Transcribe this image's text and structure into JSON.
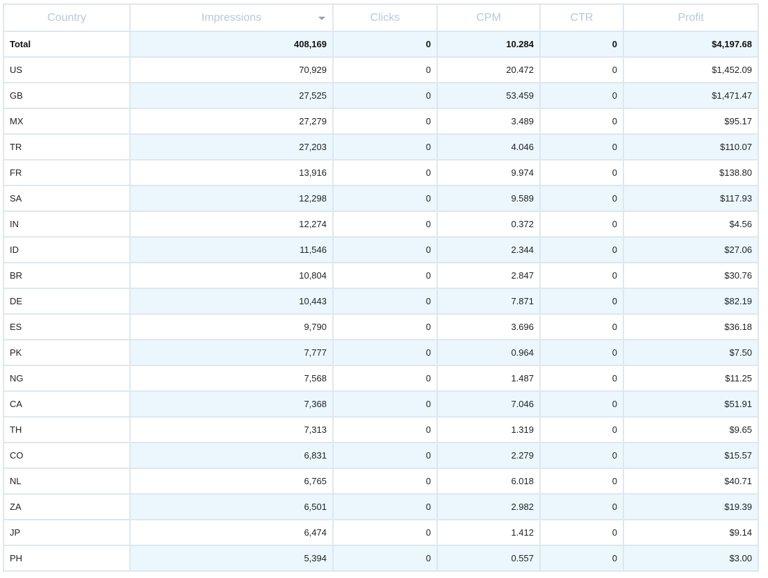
{
  "table": {
    "headers": {
      "country": "Country",
      "impressions": "Impressions",
      "clicks": "Clicks",
      "cpm": "CPM",
      "ctr": "CTR",
      "profit": "Profit"
    },
    "sort": {
      "column": "impressions",
      "direction": "desc",
      "icon": "chevron-down-icon"
    },
    "total": {
      "country": "Total",
      "impressions": "408,169",
      "clicks": "0",
      "cpm": "10.284",
      "ctr": "0",
      "profit": "$4,197.68"
    },
    "rows": [
      {
        "country": "US",
        "impressions": "70,929",
        "clicks": "0",
        "cpm": "20.472",
        "ctr": "0",
        "profit": "$1,452.09"
      },
      {
        "country": "GB",
        "impressions": "27,525",
        "clicks": "0",
        "cpm": "53.459",
        "ctr": "0",
        "profit": "$1,471.47"
      },
      {
        "country": "MX",
        "impressions": "27,279",
        "clicks": "0",
        "cpm": "3.489",
        "ctr": "0",
        "profit": "$95.17"
      },
      {
        "country": "TR",
        "impressions": "27,203",
        "clicks": "0",
        "cpm": "4.046",
        "ctr": "0",
        "profit": "$110.07"
      },
      {
        "country": "FR",
        "impressions": "13,916",
        "clicks": "0",
        "cpm": "9.974",
        "ctr": "0",
        "profit": "$138.80"
      },
      {
        "country": "SA",
        "impressions": "12,298",
        "clicks": "0",
        "cpm": "9.589",
        "ctr": "0",
        "profit": "$117.93"
      },
      {
        "country": "IN",
        "impressions": "12,274",
        "clicks": "0",
        "cpm": "0.372",
        "ctr": "0",
        "profit": "$4.56"
      },
      {
        "country": "ID",
        "impressions": "11,546",
        "clicks": "0",
        "cpm": "2.344",
        "ctr": "0",
        "profit": "$27.06"
      },
      {
        "country": "BR",
        "impressions": "10,804",
        "clicks": "0",
        "cpm": "2.847",
        "ctr": "0",
        "profit": "$30.76"
      },
      {
        "country": "DE",
        "impressions": "10,443",
        "clicks": "0",
        "cpm": "7.871",
        "ctr": "0",
        "profit": "$82.19"
      },
      {
        "country": "ES",
        "impressions": "9,790",
        "clicks": "0",
        "cpm": "3.696",
        "ctr": "0",
        "profit": "$36.18"
      },
      {
        "country": "PK",
        "impressions": "7,777",
        "clicks": "0",
        "cpm": "0.964",
        "ctr": "0",
        "profit": "$7.50"
      },
      {
        "country": "NG",
        "impressions": "7,568",
        "clicks": "0",
        "cpm": "1.487",
        "ctr": "0",
        "profit": "$11.25"
      },
      {
        "country": "CA",
        "impressions": "7,368",
        "clicks": "0",
        "cpm": "7.046",
        "ctr": "0",
        "profit": "$51.91"
      },
      {
        "country": "TH",
        "impressions": "7,313",
        "clicks": "0",
        "cpm": "1.319",
        "ctr": "0",
        "profit": "$9.65"
      },
      {
        "country": "CO",
        "impressions": "6,831",
        "clicks": "0",
        "cpm": "2.279",
        "ctr": "0",
        "profit": "$15.57"
      },
      {
        "country": "NL",
        "impressions": "6,765",
        "clicks": "0",
        "cpm": "6.018",
        "ctr": "0",
        "profit": "$40.71"
      },
      {
        "country": "ZA",
        "impressions": "6,501",
        "clicks": "0",
        "cpm": "2.982",
        "ctr": "0",
        "profit": "$19.39"
      },
      {
        "country": "JP",
        "impressions": "6,474",
        "clicks": "0",
        "cpm": "1.412",
        "ctr": "0",
        "profit": "$9.14"
      },
      {
        "country": "PH",
        "impressions": "5,394",
        "clicks": "0",
        "cpm": "0.557",
        "ctr": "0",
        "profit": "$3.00"
      }
    ]
  },
  "colors": {
    "header_text": "#b3ccd8",
    "row_highlight": "#ebf7fc",
    "border": "#dde8ee"
  }
}
